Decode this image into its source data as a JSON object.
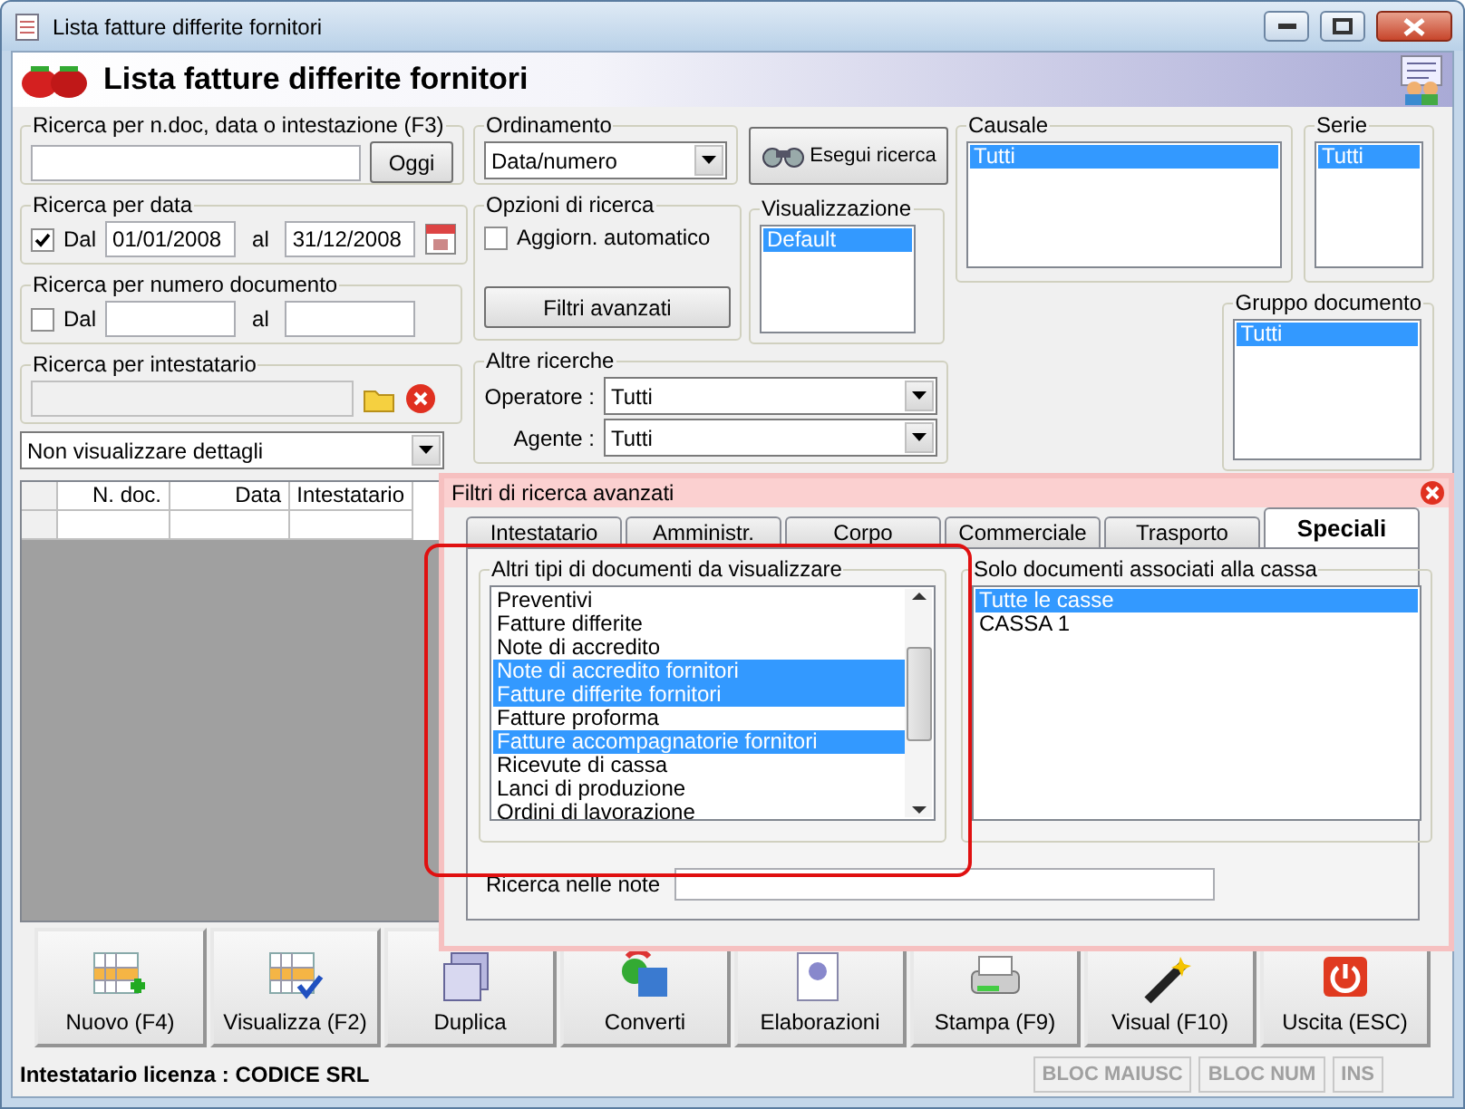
{
  "window": {
    "title": "Lista fatture differite fornitori"
  },
  "header": {
    "title": "Lista fatture differite fornitori"
  },
  "text_search": {
    "label": "Ricerca per n.doc, data o intestazione (F3)",
    "button": "Oggi"
  },
  "date_search": {
    "label": "Ricerca per data",
    "checked": true,
    "from_label": "Dal",
    "from": "01/01/2008",
    "to_label": "al",
    "to": "31/12/2008"
  },
  "number_search": {
    "label": "Ricerca per numero documento",
    "checked": false,
    "from_label": "Dal",
    "to_label": "al"
  },
  "holder_search": {
    "label": "Ricerca per intestatario"
  },
  "details_dropdown": {
    "value": "Non visualizzare dettagli"
  },
  "table": {
    "columns": [
      "N. doc.",
      "Data",
      "Intestatario"
    ]
  },
  "ordering": {
    "label": "Ordinamento",
    "value": "Data/numero"
  },
  "search_options": {
    "label": "Opzioni di ricerca",
    "auto_update": {
      "label": "Aggiorn. automatico",
      "checked": false
    },
    "advanced_button": "Filtri avanzati"
  },
  "other_searches": {
    "label": "Altre ricerche",
    "fields": [
      {
        "label": "Operatore :",
        "value": "Tutti"
      },
      {
        "label": "Agente :",
        "value": "Tutti"
      }
    ]
  },
  "search_button": "Esegui ricerca",
  "view": {
    "label": "Visualizzazione",
    "items": [
      {
        "label": "Default",
        "selected": true
      }
    ]
  },
  "causale": {
    "label": "Causale",
    "items": [
      {
        "label": "Tutti",
        "selected": true
      }
    ]
  },
  "serie": {
    "label": "Serie",
    "items": [
      {
        "label": "Tutti",
        "selected": true
      }
    ]
  },
  "document_group": {
    "label": "Gruppo documento",
    "items": [
      {
        "label": "Tutti",
        "selected": true
      }
    ]
  },
  "advanced_filters": {
    "title": "Filtri di ricerca avanzati",
    "tabs": [
      {
        "label": "Intestatario",
        "selected": false
      },
      {
        "label": "Amministr.",
        "selected": false
      },
      {
        "label": "Corpo",
        "selected": false
      },
      {
        "label": "Commerciale",
        "selected": false
      },
      {
        "label": "Trasporto",
        "selected": false
      },
      {
        "label": "Speciali",
        "selected": true
      }
    ],
    "document_types": {
      "label": "Altri tipi di documenti da visualizzare",
      "items": [
        {
          "label": "Preventivi",
          "selected": false
        },
        {
          "label": "Fatture differite",
          "selected": false
        },
        {
          "label": "Note di accredito",
          "selected": false
        },
        {
          "label": "Note di accredito fornitori",
          "selected": true
        },
        {
          "label": "Fatture differite fornitori",
          "selected": true
        },
        {
          "label": "Fatture proforma",
          "selected": false
        },
        {
          "label": "Fatture accompagnatorie fornitori",
          "selected": true
        },
        {
          "label": "Ricevute di cassa",
          "selected": false
        },
        {
          "label": "Lanci di produzione",
          "selected": false
        },
        {
          "label": "Ordini di lavorazione",
          "selected": false
        }
      ]
    },
    "cash_filter": {
      "label": "Solo documenti associati alla cassa",
      "items": [
        {
          "label": "Tutte le casse",
          "selected": true
        },
        {
          "label": "CASSA 1",
          "selected": false
        }
      ]
    },
    "notes": {
      "label": "Ricerca nelle note"
    }
  },
  "toolbar": [
    {
      "label": "Nuovo (F4)",
      "kind": "new"
    },
    {
      "label": "Visualizza (F2)",
      "kind": "view"
    },
    {
      "label": "Duplica",
      "kind": "duplicate"
    },
    {
      "label": "Converti",
      "kind": "convert"
    },
    {
      "label": "Elaborazioni",
      "kind": "process"
    },
    {
      "label": "Stampa (F9)",
      "kind": "print"
    },
    {
      "label": "Visual (F10)",
      "kind": "visual"
    },
    {
      "label": "Uscita (ESC)",
      "kind": "exit"
    }
  ],
  "status_bar": {
    "license": "Intestatario licenza : CODICE SRL",
    "indicators": [
      "BLOC MAIUSC",
      "BLOC NUM",
      "INS"
    ]
  }
}
